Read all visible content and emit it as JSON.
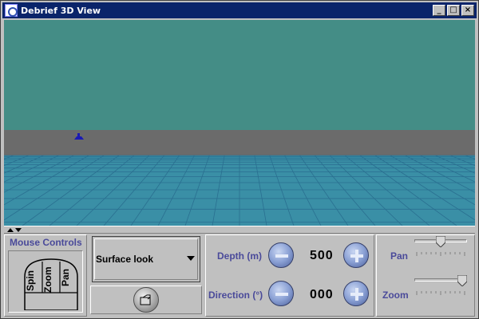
{
  "window": {
    "title": "Debrief 3D View",
    "controls": {
      "minimize": "_",
      "maximize": "□",
      "close": "×"
    }
  },
  "scene": {
    "sky_color": "#448d86",
    "horizon_color": "#6b6b6b",
    "sea_color": "#3a8fa6",
    "grid_color": "#2a6f90",
    "vessel_color": "#1a1ab4"
  },
  "mouse_controls": {
    "title": "Mouse Controls",
    "buttons": [
      "Spin",
      "Zoom",
      "Pan"
    ]
  },
  "view_mode": {
    "selected": "Surface look"
  },
  "depth": {
    "label": "Depth (m)",
    "value": "500"
  },
  "direction": {
    "label": "Direction (°)",
    "value": "000"
  },
  "pan": {
    "label": "Pan",
    "level": 0.5
  },
  "zoom": {
    "label": "Zoom",
    "level": 1.0
  },
  "icons": {
    "camera_button": "snapshot-icon",
    "decrement": "minus-icon",
    "increment": "plus-icon"
  }
}
